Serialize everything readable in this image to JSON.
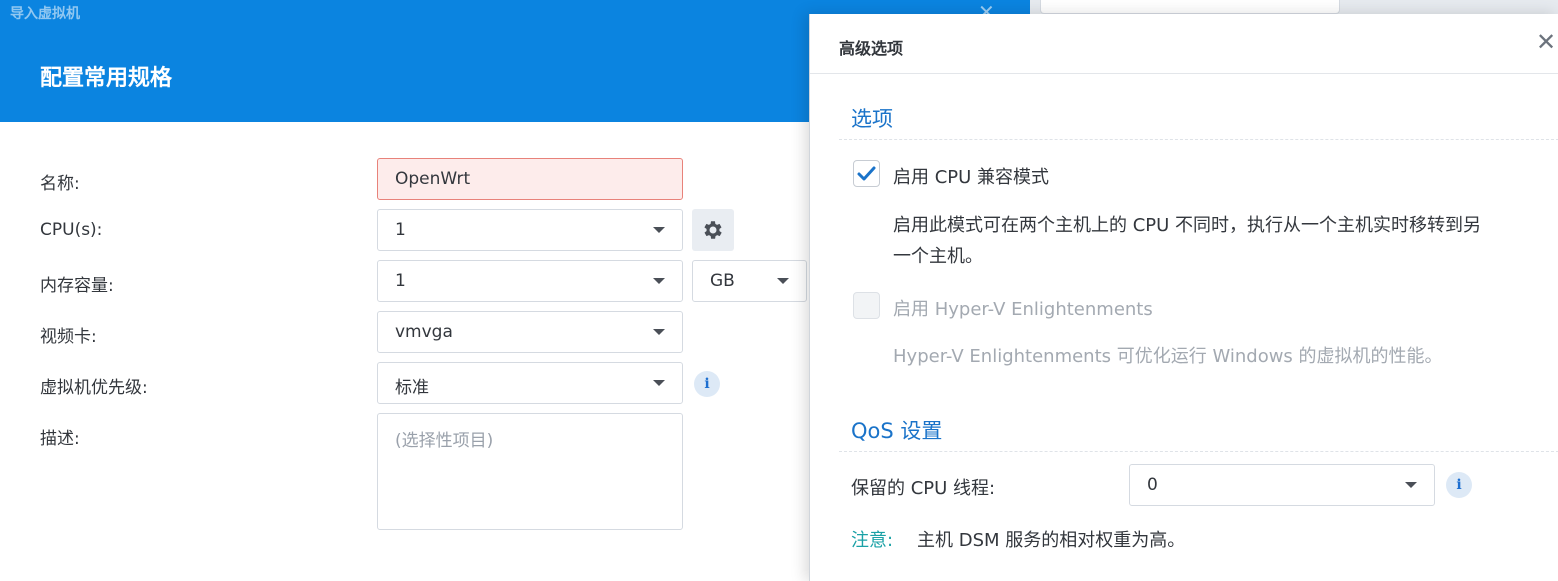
{
  "wizard": {
    "window_title": "导入虚拟机",
    "close_glyph": "✕",
    "heading": "配置常用规格",
    "name_label": "名称:",
    "name_value": "OpenWrt",
    "cpu_label": "CPU(s):",
    "cpu_value": "1",
    "memory_label": "内存容量:",
    "memory_value": "1",
    "memory_unit": "GB",
    "video_label": "视频卡:",
    "video_value": "vmvga",
    "priority_label": "虚拟机优先级:",
    "priority_value": "标准",
    "desc_label": "描述:",
    "desc_placeholder": "(选择性项目)",
    "info_glyph": "i"
  },
  "dialog": {
    "title": "高级选项",
    "close_glyph": "✕",
    "options_section": "选项",
    "cpu_compat": {
      "label": "启用 CPU 兼容模式",
      "checked": true,
      "description_line1": "启用此模式可在两个主机上的 CPU 不同时，执行从一个主机实时移转到另",
      "description_line2": "一个主机。"
    },
    "hyperv": {
      "label": "启用 Hyper-V Enlightenments",
      "checked": false,
      "disabled": true,
      "description": "Hyper-V Enlightenments 可优化运行 Windows 的虚拟机的性能。"
    },
    "qos_section": "QoS 设置",
    "reserve_label": "保留的 CPU 线程:",
    "reserve_value": "0",
    "note_label": "注意:",
    "note_text": "主机 DSM 服务的相对权重为高。",
    "info_glyph": "i"
  },
  "colors": {
    "accent_blue": "#0b84e0",
    "section_blue": "#1a73c9",
    "note_teal": "#1aa1a6",
    "error_border": "#e8827a"
  },
  "icons": [
    "gear-icon",
    "info-icon",
    "close-icon",
    "check-icon",
    "dropdown-caret-icon"
  ]
}
